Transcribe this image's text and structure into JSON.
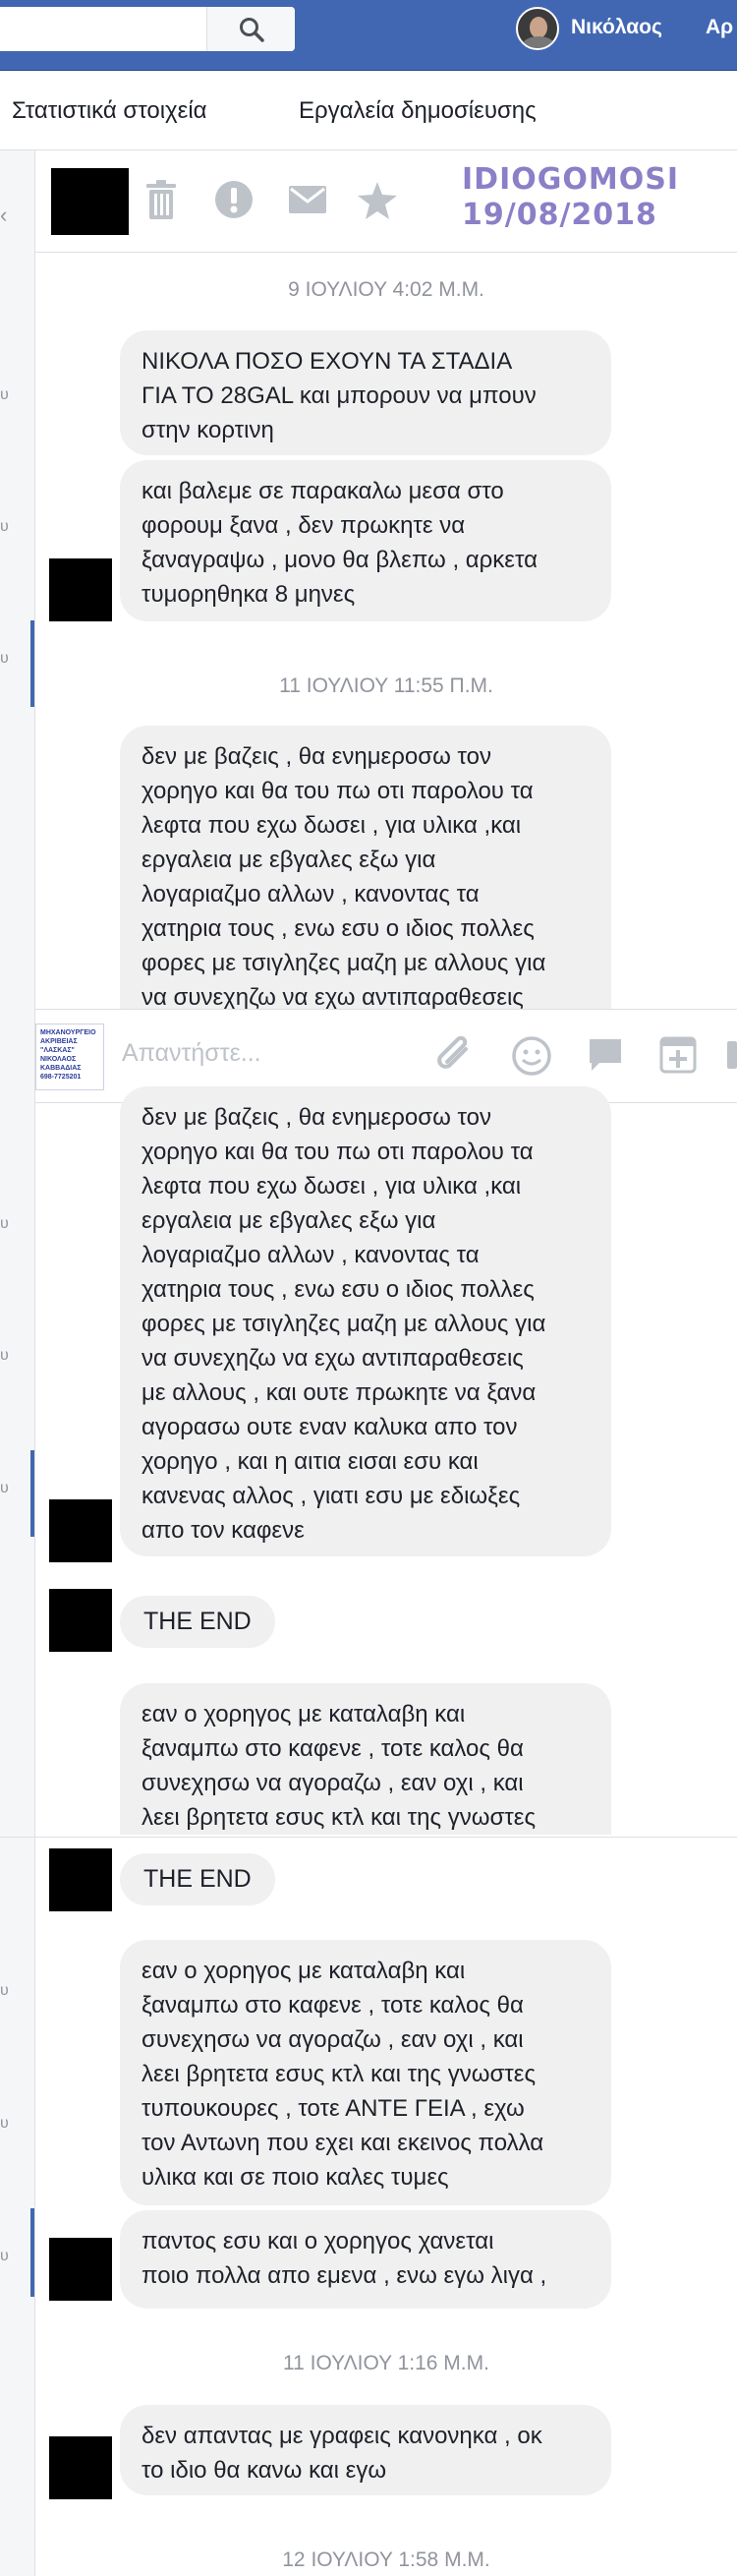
{
  "topbar": {
    "user_name": "Νικόλαος",
    "nav_cut": "Αρ"
  },
  "tabs": [
    {
      "label": "Στατιστικά στοιχεία"
    },
    {
      "label": "Εργαλεία δημοσίευσης"
    }
  ],
  "left_col": {
    "marks": [
      "‹",
      "υ",
      "υ",
      "υ",
      "υ",
      "υ",
      "υ",
      "υ",
      "υ",
      "υ"
    ]
  },
  "message_header": {
    "label_line1": "IDIOGOMOSI",
    "label_line2": "19/08/2018"
  },
  "conversation": {
    "date1": "9 ΙΟΥΛΙΟΥ 4:02 Μ.Μ.",
    "msg1": "ΝΙΚΟΛΑ ΠΟΣΟ ΕΧΟΥΝ ΤΑ ΣΤΑΔΙΑ\nΓΙΑ ΤΟ 28GAL και μπορουν να μπουν\nστην κορτινη",
    "msg2": "και βαλεμε σε παρακαλω μεσα στο\nφορουμ ξανα , δεν πρωκητε να\nξαναγραψω , μονο θα βλεπω , αρκετα\nτυμορηθηκα 8 μηνες",
    "date2": "11 ΙΟΥΛΙΟΥ 11:55 Π.Μ.",
    "msg3_partial": "δεν με βαζεις , θα ενημεροσω τον\nχορηγο και θα του πω οτι παρολου τα\nλεφτα που εχω δωσει , για υλικα ,και\nεργαλεια με εβγαλες εξω για\nλογαριαζμο αλλων , κανοντας τα\nχατηρια τους , ενω εσυ ο ιδιος πολλες\nφορες με τσιγληζες μαζη με αλλους για\nνα συνεχηζω να εχω αντιπαραθεσεις",
    "msg3_full": "δεν με βαζεις , θα ενημεροσω τον\nχορηγο και θα του πω οτι παρολου τα\nλεφτα που εχω δωσει , για υλικα ,και\nεργαλεια με εβγαλες εξω για\nλογαριαζμο αλλων , κανοντας τα\nχατηρια τους , ενω εσυ ο ιδιος πολλες\nφορες με τσιγληζες μαζη με αλλους για\nνα συνεχηζω να εχω αντιπαραθεσεις\nμε αλλους ,  και ουτε πρωκητε να ξανα\nαγορασω ουτε εναν καλυκα απο τον\nχορηγο , και η αιτια εισαι εσυ και\nκανενας αλλος , γιατι εσυ με εδιωξες\nαπο τον καφενε",
    "the_end": "THE END",
    "msg4_partial": "εαν ο χορηγος με καταλαβη και\nξαναμπω στο καφενε , τοτε καλος θα\nσυνεχησω να αγοραζω , εαν οχι , και\nλεει βρητετα εσυς κτλ και της γνωστες",
    "the_end_2": "THE END",
    "msg4_full": "εαν ο χορηγος με καταλαβη και\nξαναμπω στο καφενε , τοτε καλος θα\nσυνεχησω να αγοραζω , εαν οχι , και\nλεει βρητετα εσυς κτλ και της γνωστες\nτυπουκουρες , τοτε ΑΝΤΕ ΓΕΙΑ , εχω\nτον Αντωνη που εχει και εκεινος πολλα\nυλικα και σε ποιο καλες τυμες",
    "msg5": "παντος εσυ  και ο χορηγος χανεται\nποιο πολλα απο εμενα , ενω εγω λιγα ,",
    "date3": "11 ΙΟΥΛΙΟΥ 1:16 Μ.Μ.",
    "msg6": "δεν απαντας με γραφεις κανονηκα , οκ\nτο ιδιο θα κανω και εγω",
    "date4": "12 ΙΟΥΛΙΟΥ 1:58 Μ.Μ."
  },
  "reply_bar": {
    "placeholder": "Απαντήστε...",
    "thumb_lines": [
      "ΜΗΧΑΝΟΥΡΓΕΙΟ",
      "ΑΚΡΙΒΕΙΑΣ",
      "\"ΛΑΣΚΑΣ\"",
      "ΝΙΚΟΛΑΟΣ",
      "ΚΑΒΒΑΔΙΑΣ",
      "698-7725201"
    ]
  },
  "colors": {
    "topbar": "#4267b2",
    "bubble": "#f1f0f0",
    "accent": "#4267b2",
    "header_label": "#8b7fc7"
  }
}
